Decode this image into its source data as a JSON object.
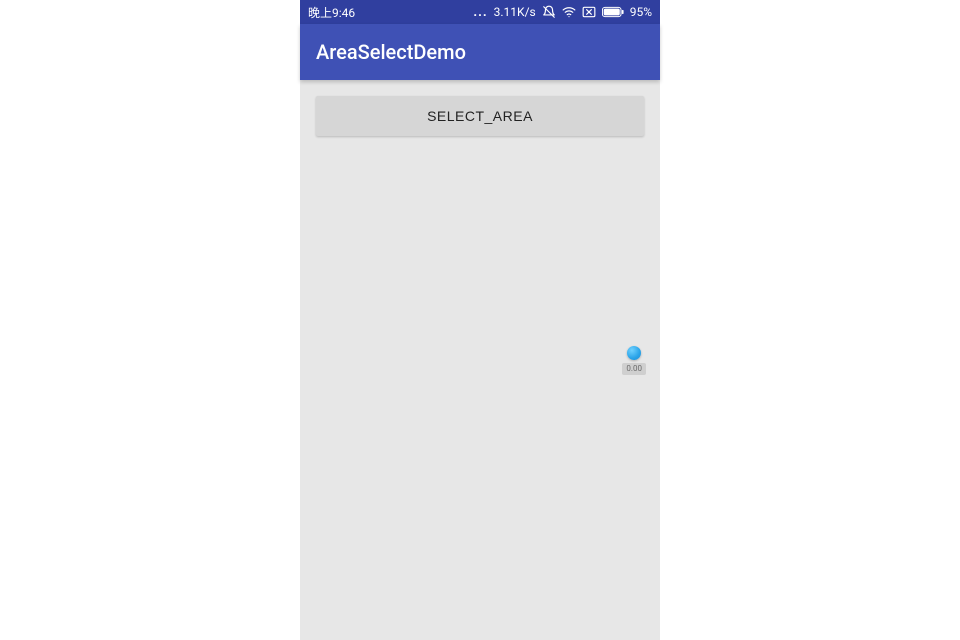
{
  "status": {
    "time": "晚上9:46",
    "dots": "...",
    "net": "3.11K/s",
    "battery_pct": "95%"
  },
  "appbar": {
    "title": "AreaSelectDemo"
  },
  "content": {
    "select_button_label": "SELECT_AREA"
  },
  "float": {
    "label": "0.00"
  }
}
